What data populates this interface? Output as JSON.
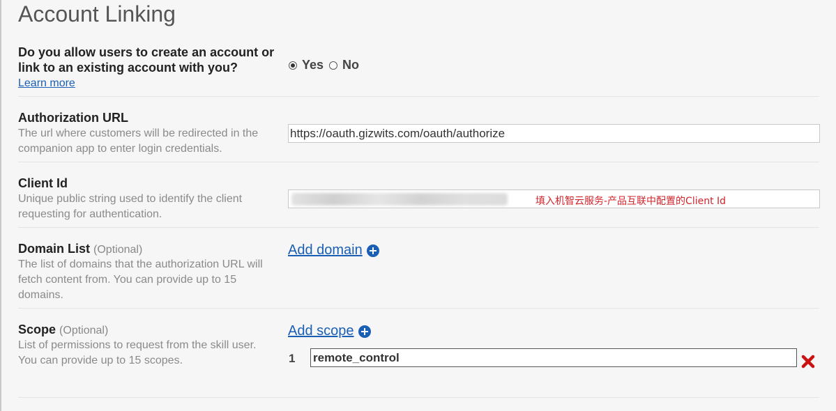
{
  "page": {
    "title": "Account Linking"
  },
  "allow_linking": {
    "question": "Do you allow users to create an account or link to an existing account with you?",
    "learn_more": "Learn more",
    "options": [
      "Yes",
      "No"
    ],
    "selected": "Yes"
  },
  "authorization_url": {
    "label": "Authorization URL",
    "description": "The url where customers will be redirected in the companion app to enter login credentials.",
    "value": "https://oauth.gizwits.com/oauth/authorize"
  },
  "client_id": {
    "label": "Client Id",
    "description": "Unique public string used to identify the client requesting for authentication.",
    "annotation": "填入机智云服务-产品互联中配置的Client Id"
  },
  "domain_list": {
    "label": "Domain List",
    "optional": "(Optional)",
    "description": "The list of domains that the authorization URL will fetch content from. You can provide up to 15 domains.",
    "add_label": "Add domain"
  },
  "scope": {
    "label": "Scope",
    "optional": "(Optional)",
    "description": "List of permissions to request from the skill user. You can provide up to 15 scopes.",
    "add_label": "Add scope",
    "items": [
      {
        "index": "1",
        "value": "remote_control"
      }
    ]
  },
  "colors": {
    "link": "#1a5fb4",
    "delete": "#cc1111",
    "annotation": "#d0242b"
  },
  "icons": {
    "add": "plus-circle-icon",
    "delete": "x-delete-icon"
  }
}
